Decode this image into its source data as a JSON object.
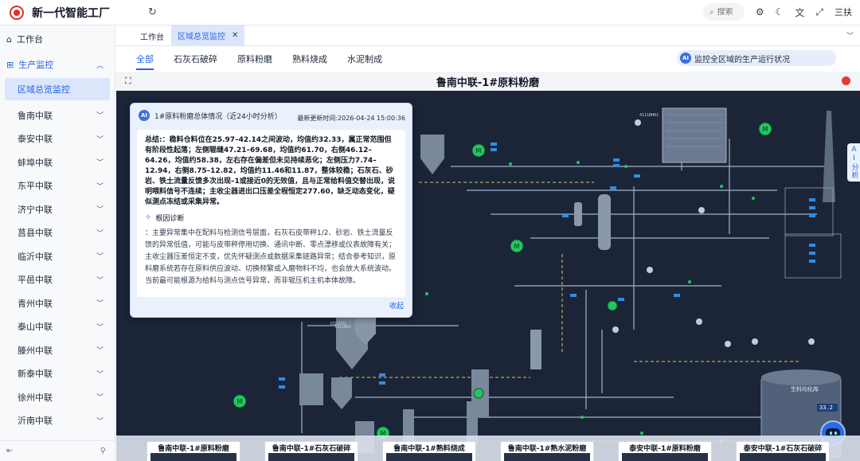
{
  "header": {
    "app_title": "新一代智能工厂",
    "search_placeholder": "搜索",
    "user": "三扶"
  },
  "sidebar": {
    "workbench": "工作台",
    "group": "生产监控",
    "active_item": "区域总览监控",
    "items": [
      "鲁南中联",
      "泰安中联",
      "蚌埠中联",
      "东平中联",
      "济宁中联",
      "莒县中联",
      "临沂中联",
      "平邑中联",
      "青州中联",
      "泰山中联",
      "滕州中联",
      "新泰中联",
      "徐州中联",
      "沂南中联"
    ]
  },
  "tabs": {
    "home": "工作台",
    "active": "区域总览监控"
  },
  "subtabs": [
    "全部",
    "石灰石破碎",
    "原料粉磨",
    "熟料烧成",
    "水泥制成"
  ],
  "ai_banner": {
    "badge": "AI",
    "text": "监控全区域的生产运行状况"
  },
  "panel": {
    "title": "鲁南中联-1#原料粉磨"
  },
  "scada": {
    "equipment": {
      "mill": "4111BH01",
      "silo": "3311P01",
      "bin": "3311B01",
      "homogenizer": "生料均化库",
      "homogenizer_value": "33.2"
    }
  },
  "ai_panel": {
    "badge": "AI",
    "title": "1#原料粉磨总体情况（近24小时分析）",
    "update_time": "最新更新时间:2026-04-24 15:00:36",
    "summary": "总结:：稳料仓料位在25.97–42.14之间波动，均值约32.33，属正常范围但有阶段性起落；左侧辊缝47.21–69.68，均值约61.70，右侧46.12–64.26，均值约58.38，左右存在偏差但未见持续恶化；左侧压力7.74–12.94，右侧8.75–12.82，均值约11.46和11.87，整体较稳；石灰石、砂岩、铁土流量反馈多次出现–1或接近0的无效值，且与正常给料值交替出现，说明喂料信号不连续；主收尘器进出口压差全程恒定277.60，缺乏动态变化，疑似测点冻结或采集异常。",
    "diag_label": "根因诊断",
    "diagnosis": "：主要异常集中在配料与检测信号层面，石灰石皮带秤1/2、砂岩、铁土流量反馈的异常低值，可能与皮带秤停用切换、通讯中断、零点漂移或仪表故障有关；主收尘器压差恒定不变，优先怀疑测点或数据采集链路异常；结合参考知识，原料磨系统若存在原料供应波动、切换频繁或入磨物料不均，也会放大系统波动。当前最可能根源为给料与测点信号异常，而非辊压机主机本体故障。",
    "collapse": "收起"
  },
  "ai_side": {
    "label": "AI分析"
  },
  "thumbs": [
    "鲁南中联-1#原料粉磨",
    "鲁南中联-1#石灰石破碎",
    "鲁南中联-1#熟料烧成",
    "鲁南中联-1#熟水泥粉磨",
    "泰安中联-1#原料粉磨",
    "泰安中联-1#石灰石破碎"
  ],
  "colors": {
    "accent": "#2563eb",
    "scada_bg": "#1b2537",
    "motor_green": "#22c55e",
    "alarm_red": "#e23a3a"
  }
}
